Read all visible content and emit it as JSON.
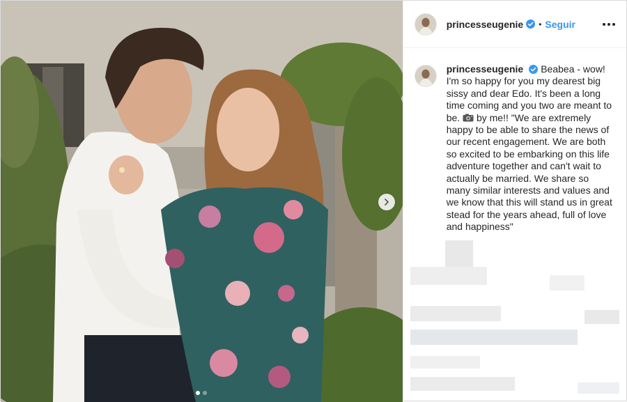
{
  "post": {
    "username": "princesseugenie",
    "follow_label": "Seguir",
    "separator": "•",
    "caption": {
      "username": "princesseugenie",
      "part1": "Beabea - wow! I'm so happy for you my dearest big sissy and dear Edo. It's been a long time coming and you two are meant to be.",
      "part2": "by me!! \"We are extremely happy to be able to share the news of our recent engagement. We are both so excited to be embarking on this life adventure together and can't wait to actually be married. We share so many similar interests and values and we know that this will stand us in great stead for the years ahead, full of love and happiness\""
    },
    "carousel": {
      "total": 2,
      "active": 1
    }
  },
  "icons": {
    "verified": "verified-badge-icon",
    "more": "more-options-icon",
    "next": "chevron-right-icon",
    "camera": "camera-icon"
  },
  "colors": {
    "accent": "#3897f0",
    "verified": "#3897f0",
    "text": "#262626",
    "border": "#dbdbdb"
  }
}
